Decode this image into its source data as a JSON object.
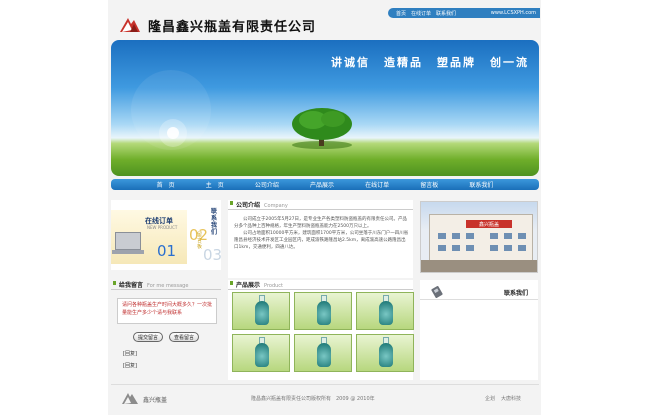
{
  "top_links": [
    "首页",
    "在线订单",
    "联系我们"
  ],
  "top_url": "www.LCSXPH.com",
  "company": {
    "name": "隆昌鑫兴瓶盖有限责任公司"
  },
  "banner": {
    "slogans": [
      "讲诚信",
      "造精品",
      "塑品牌",
      "创一流"
    ]
  },
  "nav": [
    "首　页",
    "主　页",
    "公司介绍",
    "产品展示",
    "在线订单",
    "留言板",
    "联系我们"
  ],
  "promo": {
    "order_title": "在线订单",
    "order_en": "NEW PRODUCT",
    "order_num": "01",
    "order_num2": "02",
    "contact_title": "联系我们",
    "contact_sub": "留言板",
    "contact_num": "03"
  },
  "messages": {
    "title": "给我留言",
    "title_en": "For me message",
    "text": "请问各种瓶盖生产时间大概多久？一次批量能生产多少个请与我联系",
    "submit_label": "提交留言",
    "view_label": "查看留言",
    "replies": [
      "[回复]",
      "[回复]"
    ]
  },
  "about": {
    "title": "公司介绍",
    "title_en": "Company",
    "paragraphs": [
      "公司成立于2005年5月27日，是专业生产各类塑料防盗瓶盖的有限责任公司。产品分多个品种上百种规格，年生产塑料防盗瓶盖能力在2500万只以上。",
      "公司占地面积10000平方米，建筑面积1700平方米，公司坐落于川东门户一四川省隆昌县经济技术开发区工业园区内，距成渝铁路隆昌站2.5km，离成渝高速公路隆昌出口1km，交通便利，四通八达。"
    ]
  },
  "products": {
    "title": "产品展示",
    "title_en": "Product",
    "items": [
      "product-1",
      "product-2",
      "product-3",
      "product-4",
      "product-5",
      "product-6"
    ]
  },
  "photo": {
    "sign": "鑫兴瓶盖"
  },
  "contact": {
    "label": "联系我们"
  },
  "footer": {
    "brand": "鑫兴瓶盖",
    "copyright": "隆昌鑫兴瓶盖有限责任公司版权所有　2009 @ 2010年",
    "links": [
      "企划",
      "大唐科技"
    ]
  }
}
